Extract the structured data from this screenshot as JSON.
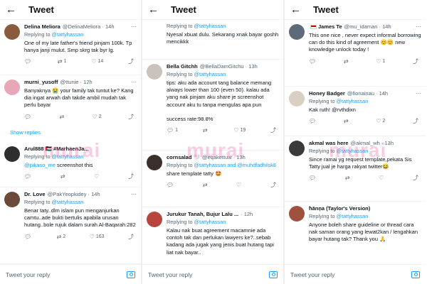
{
  "header": {
    "title": "Tweet"
  },
  "footer": {
    "placeholder": "Tweet your reply"
  },
  "watermark": "murai",
  "colors": {
    "link": "#1d9bf0",
    "watermark": "#e84896"
  },
  "panel1": {
    "t1": {
      "name": "Delina Meliora",
      "handle": "@DelinaMeliora · 14h",
      "replying_prefix": "Replying to",
      "replying_to": "@tattyhassan",
      "text": "One of my late father's friend pinjam 100k. Tp hanya janji mulut. Smp skrg tak byr lg.",
      "replies": "",
      "retweets": "1",
      "likes": "14"
    },
    "t2": {
      "name": "murni_yusoff",
      "handle": "@ttunie · 12h",
      "text": "Banyaknya 😭 your family tak tuntut ke? Kang dia ingat arwah dah takde ambil mudah tak perlu bayar",
      "replies": "",
      "retweets": "",
      "likes": "2"
    },
    "show_replies": "Show replies",
    "t3": {
      "name": "Arul888 🇵🇸 #MarhaenJa...",
      "handle": "",
      "replying_prefix": "Replying to",
      "replying_to": "@tattyhassan",
      "mention": "@pikaso_me",
      "text_after_mention": " screenshot this",
      "replies": "",
      "retweets": "",
      "likes": ""
    },
    "t4": {
      "name": "Dr. Love",
      "handle": "@PakYeopkidey · 14h",
      "replying_prefix": "Replying to",
      "replying_to": "@tattyhassan",
      "text": "Benar taty..dlm islam pun menganjurkan camtu..ade bukti bertulis apabila urusan hutang..bole rujuk dalam surah Al-Baqarah:282",
      "replies": "",
      "retweets": "2",
      "likes": "163"
    }
  },
  "panel2": {
    "t0": {
      "replying_prefix": "Replying to",
      "replying_to": "@tattyhassan",
      "text": "Nyesal xbuat dulu. Sekarang xnak bayar goshh mencikkk"
    },
    "t1": {
      "name": "Bella Gitchh",
      "handle": "@BellaDamGitchu · 13h",
      "replying_prefix": "Replying to",
      "replying_to": "@tattyhassan",
      "text": "tips: aku ada account tang balance memang always lower than 100 (even 50). kalau ada yang nak pinjam aku share je screenshot account aku tu tanpa mengulas apa pun\n\nsuccess rate:98.8%",
      "replies": "1",
      "retweets": "",
      "likes": "19"
    },
    "t2": {
      "name": "cornsalad 🤍",
      "handle": "@eqakettuw · 13h",
      "replying_prefix": "Replying to",
      "replying_to": "@tattyhassan and @muhdfadhilsk8",
      "text": "share template tatty 🤩",
      "replies": "",
      "retweets": "",
      "likes": ""
    },
    "t3": {
      "name": "Jurukur Tanah, Bujur Lalu ...",
      "handle": "· 12h",
      "replying_prefix": "Replying to",
      "replying_to": "@tattyhassan",
      "text": "Kalau nak buat agreement macamnie ada contoh tak dan perlukan lawyers ke?..sebab kadang ada jugak yang jenis buat hutang tapi liat nak bayar.."
    }
  },
  "panel3": {
    "t1": {
      "name": "James Te",
      "handle": "@mu_idaman · 14h",
      "text": "This one nice , never expect informal borrowing can do this kind of agreement 😊😊 new knowledge unlock today !",
      "replies": "",
      "retweets": "",
      "likes": "1"
    },
    "t2": {
      "name": "Honey Badger",
      "handle": "@fionainau · 14h",
      "replying_prefix": "Replying to",
      "replying_to": "@tattyhassan",
      "text": "Kak ruth! @rvthdixn",
      "replies": "",
      "retweets": "",
      "likes": "2"
    },
    "t3": {
      "name": "akmal was here",
      "handle": "@akmal_wh · 13h",
      "replying_prefix": "Replying to",
      "replying_to": "@tattyhassan",
      "text": "Since ramai yg request template,pekata Sis Tatty jual je harga rakyat twitter😂",
      "replies": "",
      "retweets": "",
      "likes": ""
    },
    "t4": {
      "name": "ħānņa (Taylor's Version)",
      "handle": "",
      "replying_prefix": "Replying to",
      "replying_to": "@tattyhassan",
      "text": "Anyone boleh share guideline or thread cara nak saman orang yang lewat2kan / lengahkan bayar hutang tak? Thank you 🙏"
    }
  }
}
